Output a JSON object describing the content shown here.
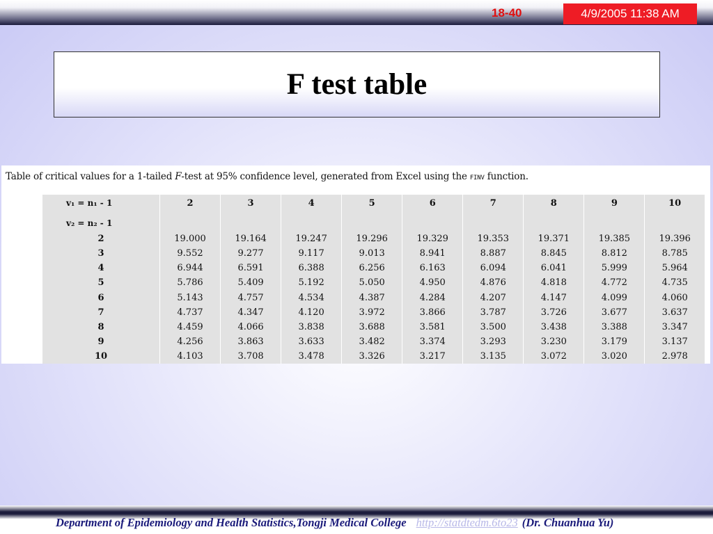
{
  "header": {
    "slide_number": "18-40",
    "datetime": "4/9/2005 11:38 AM"
  },
  "title": "F test table",
  "table": {
    "caption_pre": "Table of critical values for a 1-tailed ",
    "caption_f": "F",
    "caption_mid": "-test at 95% confidence level, generated from Excel using the ",
    "caption_func": "FINV",
    "caption_post": " function.",
    "corner_row1": "v₁ = n₁ - 1",
    "corner_row2": "v₂ = n₂ - 1",
    "column_headers": [
      "2",
      "3",
      "4",
      "5",
      "6",
      "7",
      "8",
      "9",
      "10"
    ],
    "rows": [
      {
        "label": "2",
        "values": [
          "19.000",
          "19.164",
          "19.247",
          "19.296",
          "19.329",
          "19.353",
          "19.371",
          "19.385",
          "19.396"
        ]
      },
      {
        "label": "3",
        "values": [
          "9.552",
          "9.277",
          "9.117",
          "9.013",
          "8.941",
          "8.887",
          "8.845",
          "8.812",
          "8.785"
        ]
      },
      {
        "label": "4",
        "values": [
          "6.944",
          "6.591",
          "6.388",
          "6.256",
          "6.163",
          "6.094",
          "6.041",
          "5.999",
          "5.964"
        ]
      },
      {
        "label": "5",
        "values": [
          "5.786",
          "5.409",
          "5.192",
          "5.050",
          "4.950",
          "4.876",
          "4.818",
          "4.772",
          "4.735"
        ]
      },
      {
        "label": "6",
        "values": [
          "5.143",
          "4.757",
          "4.534",
          "4.387",
          "4.284",
          "4.207",
          "4.147",
          "4.099",
          "4.060"
        ]
      },
      {
        "label": "7",
        "values": [
          "4.737",
          "4.347",
          "4.120",
          "3.972",
          "3.866",
          "3.787",
          "3.726",
          "3.677",
          "3.637"
        ]
      },
      {
        "label": "8",
        "values": [
          "4.459",
          "4.066",
          "3.838",
          "3.688",
          "3.581",
          "3.500",
          "3.438",
          "3.388",
          "3.347"
        ]
      },
      {
        "label": "9",
        "values": [
          "4.256",
          "3.863",
          "3.633",
          "3.482",
          "3.374",
          "3.293",
          "3.230",
          "3.179",
          "3.137"
        ]
      },
      {
        "label": "10",
        "values": [
          "4.103",
          "3.708",
          "3.478",
          "3.326",
          "3.217",
          "3.135",
          "3.072",
          "3.020",
          "2.978"
        ]
      }
    ]
  },
  "footer": {
    "department": "Department of Epidemiology and Health Statistics,Tongji Medical College",
    "link": "http://statdtedm.6to23",
    "author": "(Dr. Chuanhua Yu)"
  },
  "colors": {
    "slide_number": "#e01010",
    "date_box": "#ee1c25",
    "footer_text": "#1a1a7a",
    "table_bg": "#e2e2e2"
  }
}
